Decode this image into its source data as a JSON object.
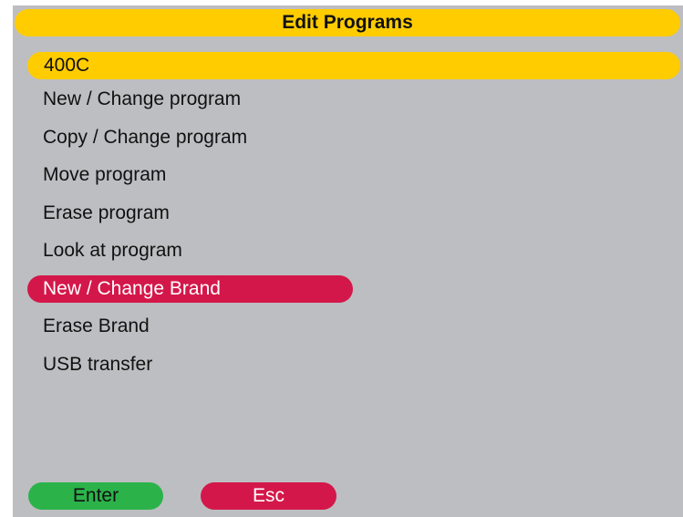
{
  "header": {
    "title": "Edit Programs"
  },
  "brand": {
    "name": "400C"
  },
  "menu": {
    "items": [
      {
        "label": "New / Change program"
      },
      {
        "label": "Copy / Change program"
      },
      {
        "label": "Move program"
      },
      {
        "label": "Erase program"
      },
      {
        "label": "Look at program"
      },
      {
        "label": "New / Change Brand",
        "selected": true
      },
      {
        "label": "Erase Brand"
      },
      {
        "label": "USB transfer"
      }
    ]
  },
  "softkeys": {
    "enter_label": "Enter",
    "esc_label": "Esc"
  },
  "colors": {
    "screen_background": "#bdbec1",
    "title_bar": "#ffcc00",
    "selection": "#d4174a",
    "enter_key": "#2bb34a",
    "esc_key": "#d4174a"
  }
}
